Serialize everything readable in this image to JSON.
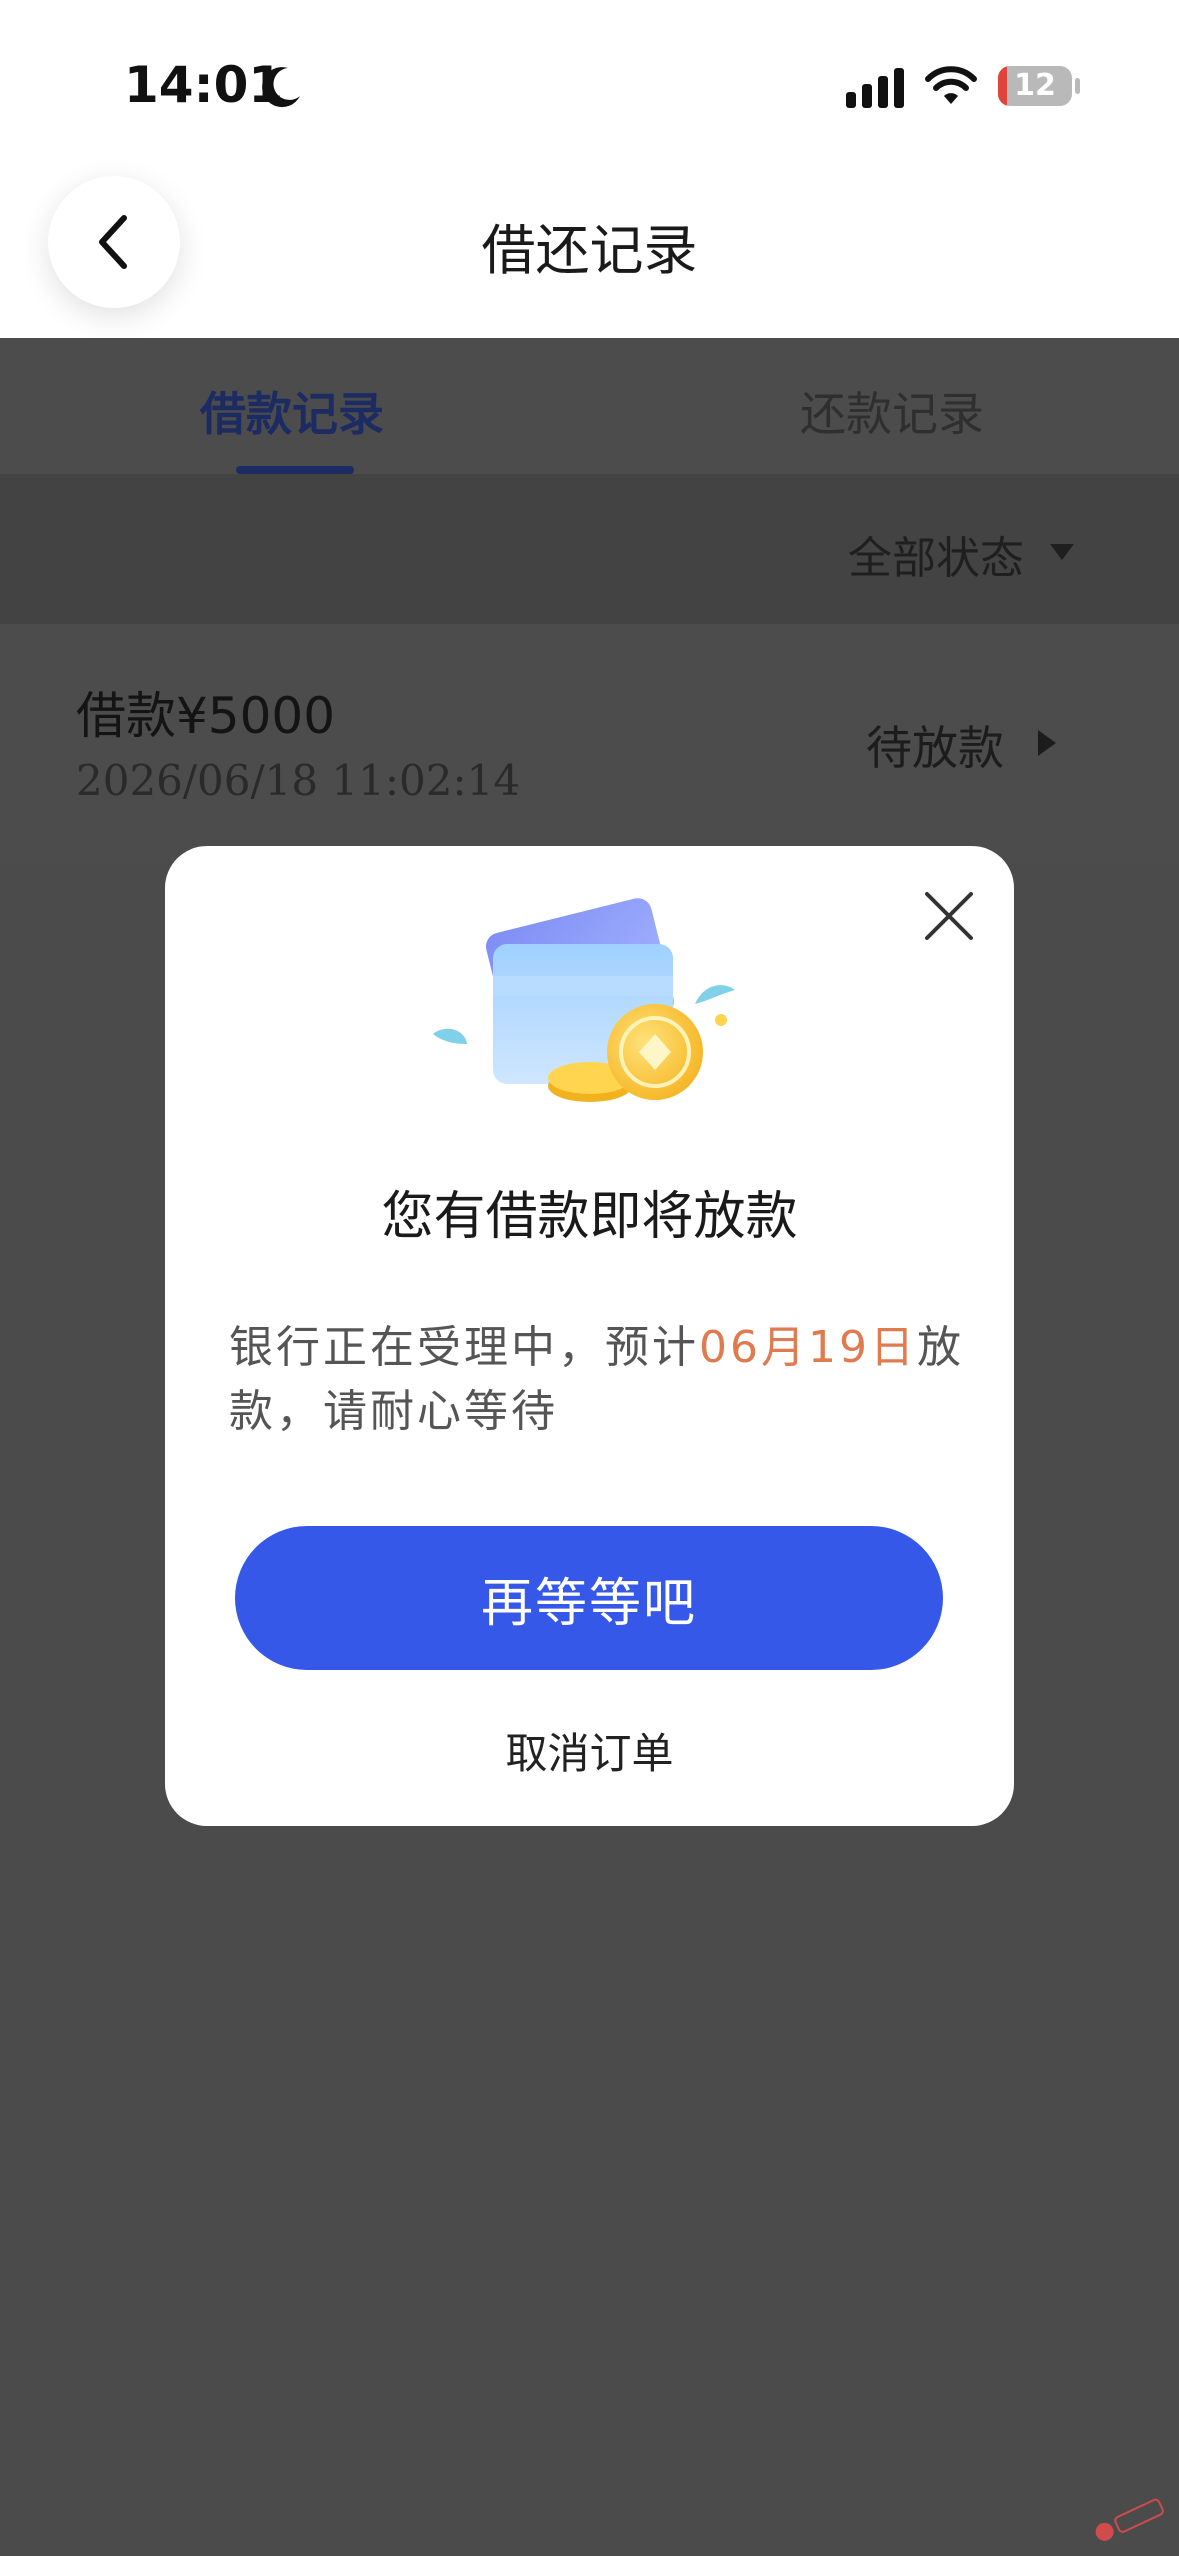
{
  "status_bar": {
    "time": "14:01",
    "battery_text": "12",
    "battery_level": 0.12
  },
  "nav": {
    "title": "借还记录"
  },
  "tabs": [
    {
      "label": "借款记录",
      "active": true
    },
    {
      "label": "还款记录",
      "active": false
    }
  ],
  "filter": {
    "label": "全部状态"
  },
  "records": [
    {
      "amount": "借款¥5000",
      "time": "2026/06/18 11:02:14",
      "status": "待放款"
    }
  ],
  "modal": {
    "title": "您有借款即将放款",
    "body_before": "银行正在受理中，预计",
    "body_highlight": "06月19日",
    "body_after": "放款，请耐心等待",
    "primary_button": "再等等吧",
    "cancel_link": "取消订单"
  },
  "colors": {
    "primary": "#3558e8",
    "highlight": "#e07a4f",
    "active_tab": "#1d2b63"
  }
}
